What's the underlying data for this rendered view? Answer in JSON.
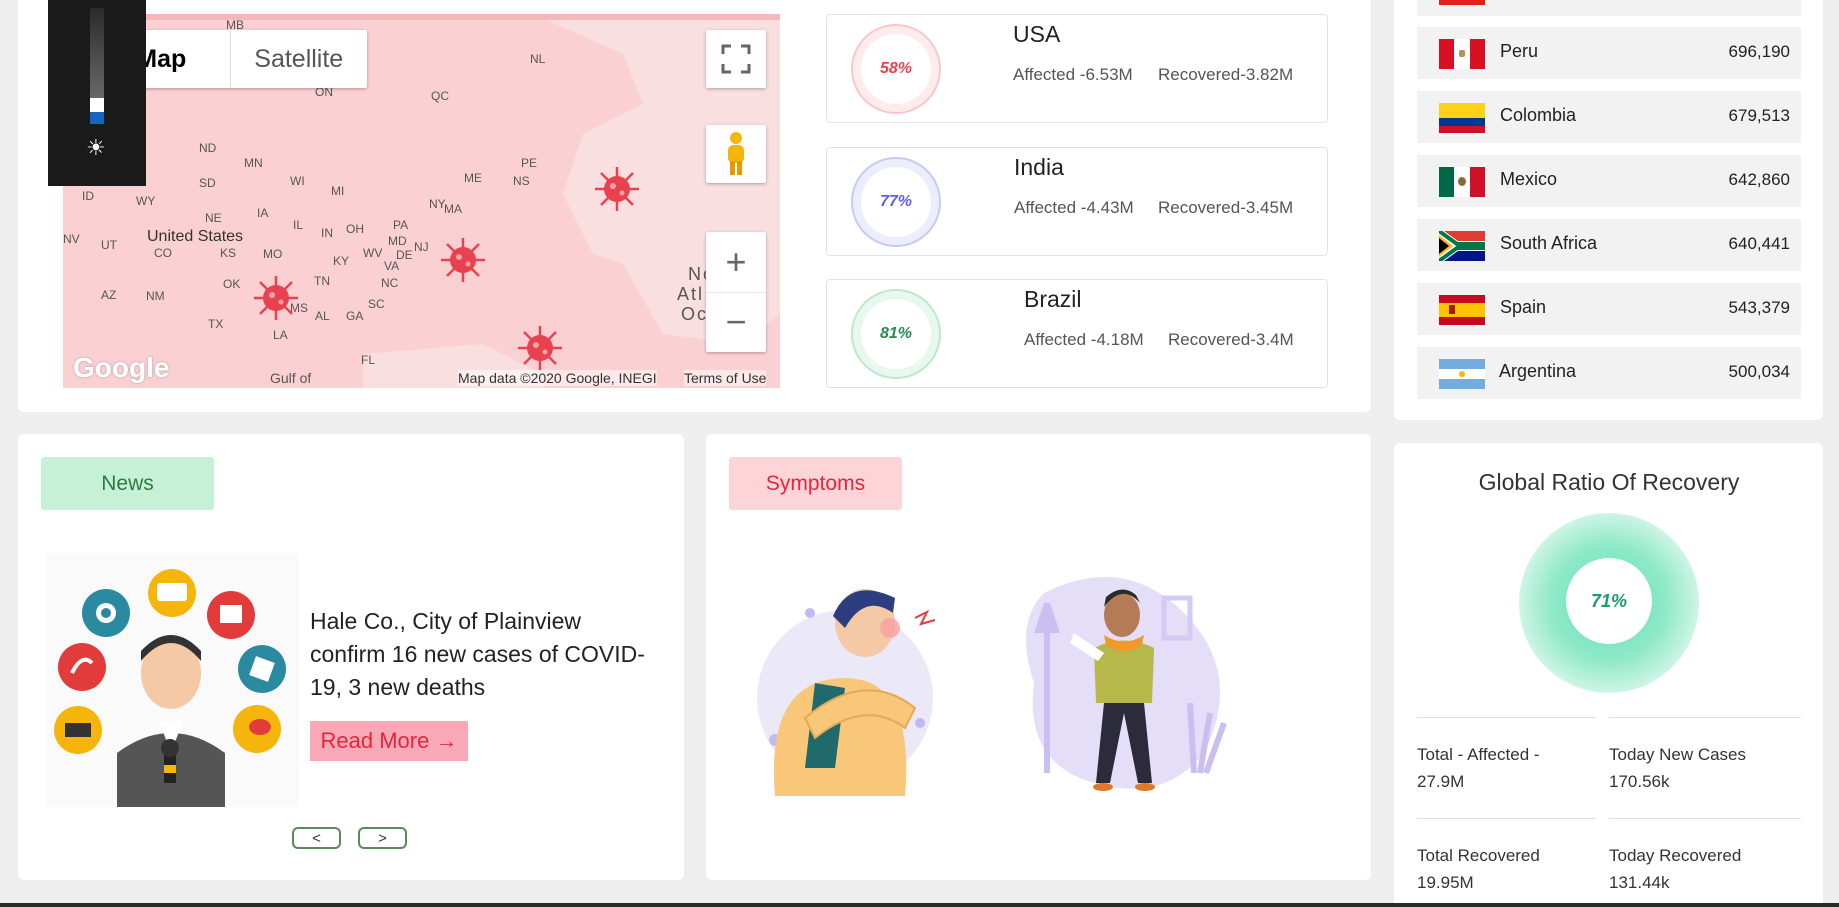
{
  "map": {
    "map_tab": "Map",
    "satellite_tab": "Satellite",
    "attribution": "Map data ©2020 Google, INEGI",
    "terms": "Terms of Use",
    "google_logo": "Google",
    "labels": {
      "mb": "MB",
      "on": "ON",
      "qc": "QC",
      "nl": "NL",
      "nd": "ND",
      "mn": "MN",
      "wi": "WI",
      "mi": "MI",
      "sd": "SD",
      "id": "ID",
      "wy": "WY",
      "ne": "NE",
      "ia": "IA",
      "il": "IL",
      "in": "IN",
      "oh": "OH",
      "pa": "PA",
      "ny": "NY",
      "me": "ME",
      "ns": "NS",
      "pe": "PE",
      "ma": "MA",
      "nj": "NJ",
      "md": "MD",
      "de": "DE",
      "nv": "NV",
      "ut": "UT",
      "co": "CO",
      "ks": "KS",
      "mo": "MO",
      "ky": "KY",
      "wv": "WV",
      "va": "VA",
      "ok": "OK",
      "tn": "TN",
      "nc": "NC",
      "az": "AZ",
      "nm": "NM",
      "ms": "MS",
      "al": "AL",
      "ga": "GA",
      "sc": "SC",
      "tx": "TX",
      "la": "LA",
      "fl": "FL",
      "us": "United States",
      "gulf": "Gulf of",
      "no": "No",
      "atl": "Atl",
      "oc": "Oc"
    }
  },
  "stats": [
    {
      "country": "USA",
      "percent": "58%",
      "affected": "Affected -6.53M",
      "recovered": "Recovered-3.82M",
      "color": "#e8414f",
      "ring": "#f9c7cb"
    },
    {
      "country": "India",
      "percent": "77%",
      "affected": "Affected -4.43M",
      "recovered": "Recovered-3.45M",
      "color": "#5d5ee0",
      "ring": "#c8c9f5"
    },
    {
      "country": "Brazil",
      "percent": "81%",
      "affected": "Affected -4.18M",
      "recovered": "Recovered-3.4M",
      "color": "#2a8a4d",
      "ring": "#bde8cd"
    }
  ],
  "countries": [
    {
      "name": "Peru",
      "value": "696,190"
    },
    {
      "name": "Colombia",
      "value": "679,513"
    },
    {
      "name": "Mexico",
      "value": "642,860"
    },
    {
      "name": "South Africa",
      "value": "640,441"
    },
    {
      "name": "Spain",
      "value": "543,379"
    },
    {
      "name": "Argentina",
      "value": "500,034"
    }
  ],
  "news": {
    "tag": "News",
    "headline": "Hale Co., City of Plainview confirm 16 new cases of COVID-19, 3 new deaths",
    "read_more": "Read More →",
    "prev": "<",
    "next": ">"
  },
  "symptoms": {
    "tag": "Symptoms"
  },
  "recovery": {
    "title": "Global Ratio Of Recovery",
    "percent": "71%",
    "total_affected": "Total - Affected - 27.9M",
    "today_new_cases_label": "Today New Cases",
    "today_new_cases_value": "170.56k",
    "total_recovered_label": "Total Recovered",
    "total_recovered_value": "19.95M",
    "today_recovered_label": "Today Recovered",
    "today_recovered_value": "131.44k"
  },
  "colors": {
    "news_tag_bg": "#c7f1d6",
    "news_tag_text": "#2d7a45",
    "symptoms_tag_bg": "#fdd5d8",
    "symptoms_tag_text": "#e8243c",
    "accent_green": "#1d9b6c",
    "map_red": "#e8414f"
  }
}
